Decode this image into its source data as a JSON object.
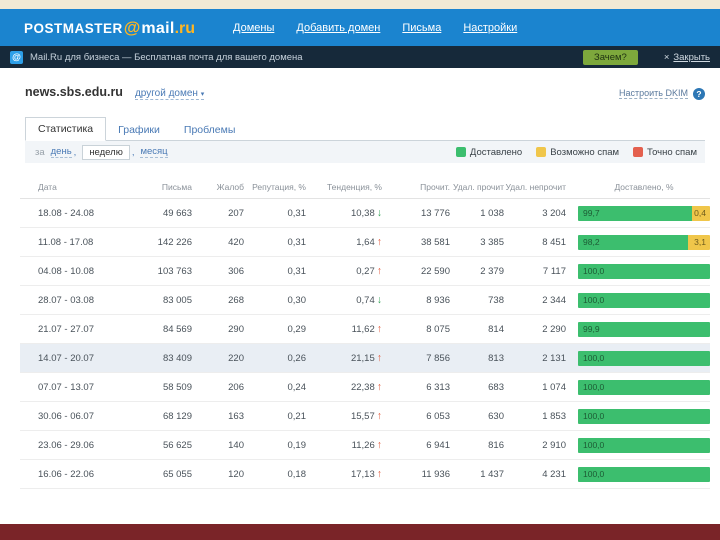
{
  "logo": {
    "postmaster": "POSTMASTER",
    "at": "@",
    "mail": "mail",
    "ru": ".ru"
  },
  "nav": [
    {
      "label": "Домены"
    },
    {
      "label": "Добавить домен"
    },
    {
      "label": "Письма"
    },
    {
      "label": "Настройки"
    }
  ],
  "promo": {
    "badge": "@",
    "text": "Mail.Ru для бизнеса — Бесплатная почта для вашего домена",
    "why_button": "Зачем?",
    "close_x": "×",
    "close_label": "Закрыть"
  },
  "domain": {
    "name": "news.sbs.edu.ru",
    "switch_label": "другой домен",
    "switch_caret": "▾",
    "dkim_link": "Настроить DKIM",
    "help_icon": "?"
  },
  "tabs": [
    {
      "label": "Статистика",
      "active": true
    },
    {
      "label": "Графики",
      "active": false
    },
    {
      "label": "Проблемы",
      "active": false
    }
  ],
  "period": {
    "prefix": "за",
    "options": [
      {
        "label": "день",
        "sep": ",",
        "selected": false
      },
      {
        "label": "неделю",
        "sep": ",",
        "selected": true
      },
      {
        "label": "месяц",
        "sep": "",
        "selected": false
      }
    ]
  },
  "legend": [
    {
      "label": "Доставлено",
      "color": "#3cbe6e"
    },
    {
      "label": "Возможно спам",
      "color": "#f0c64a"
    },
    {
      "label": "Точно спам",
      "color": "#e4604e"
    }
  ],
  "table": {
    "headers": [
      "Дата",
      "Письма",
      "Жалоб",
      "Репутация, %",
      "Тенденция, %",
      "Прочит.",
      "Удал. прочит",
      "Удал. непрочит",
      "Доставлено, %"
    ],
    "rows": [
      {
        "date": "18.08 - 24.08",
        "letters": "49 663",
        "complaints": "207",
        "reputation": "0,31",
        "trend": "10,38",
        "trend_dir": "down",
        "read": "13 776",
        "deleted_read": "1 038",
        "deleted_unread": "3 204",
        "delivered": "99,7",
        "maybe_spam": "0,4",
        "highlighted": false
      },
      {
        "date": "11.08 - 17.08",
        "letters": "142 226",
        "complaints": "420",
        "reputation": "0,31",
        "trend": "1,64",
        "trend_dir": "up",
        "read": "38 581",
        "deleted_read": "3 385",
        "deleted_unread": "8 451",
        "delivered": "98,2",
        "maybe_spam": "3,1",
        "highlighted": false
      },
      {
        "date": "04.08 - 10.08",
        "letters": "103 763",
        "complaints": "306",
        "reputation": "0,31",
        "trend": "0,27",
        "trend_dir": "up",
        "read": "22 590",
        "deleted_read": "2 379",
        "deleted_unread": "7 117",
        "delivered": "100,0",
        "maybe_spam": null,
        "highlighted": false
      },
      {
        "date": "28.07 - 03.08",
        "letters": "83 005",
        "complaints": "268",
        "reputation": "0,30",
        "trend": "0,74",
        "trend_dir": "down",
        "read": "8 936",
        "deleted_read": "738",
        "deleted_unread": "2 344",
        "delivered": "100,0",
        "maybe_spam": null,
        "highlighted": false
      },
      {
        "date": "21.07 - 27.07",
        "letters": "84 569",
        "complaints": "290",
        "reputation": "0,29",
        "trend": "11,62",
        "trend_dir": "up",
        "read": "8 075",
        "deleted_read": "814",
        "deleted_unread": "2 290",
        "delivered": "99,9",
        "maybe_spam": null,
        "highlighted": false
      },
      {
        "date": "14.07 - 20.07",
        "letters": "83 409",
        "complaints": "220",
        "reputation": "0,26",
        "trend": "21,15",
        "trend_dir": "up",
        "read": "7 856",
        "deleted_read": "813",
        "deleted_unread": "2 131",
        "delivered": "100,0",
        "maybe_spam": null,
        "highlighted": true
      },
      {
        "date": "07.07 - 13.07",
        "letters": "58 509",
        "complaints": "206",
        "reputation": "0,24",
        "trend": "22,38",
        "trend_dir": "up",
        "read": "6 313",
        "deleted_read": "683",
        "deleted_unread": "1 074",
        "delivered": "100,0",
        "maybe_spam": null,
        "highlighted": false
      },
      {
        "date": "30.06 - 06.07",
        "letters": "68 129",
        "complaints": "163",
        "reputation": "0,21",
        "trend": "15,57",
        "trend_dir": "up",
        "read": "6 053",
        "deleted_read": "630",
        "deleted_unread": "1 853",
        "delivered": "100,0",
        "maybe_spam": null,
        "highlighted": false
      },
      {
        "date": "23.06 - 29.06",
        "letters": "56 625",
        "complaints": "140",
        "reputation": "0,19",
        "trend": "11,26",
        "trend_dir": "up",
        "read": "6 941",
        "deleted_read": "816",
        "deleted_unread": "2 910",
        "delivered": "100,0",
        "maybe_spam": null,
        "highlighted": false
      },
      {
        "date": "16.06 - 22.06",
        "letters": "65 055",
        "complaints": "120",
        "reputation": "0,18",
        "trend": "17,13",
        "trend_dir": "up",
        "read": "11 936",
        "deleted_read": "1 437",
        "deleted_unread": "4 231",
        "delivered": "100,0",
        "maybe_spam": null,
        "highlighted": false
      }
    ]
  }
}
